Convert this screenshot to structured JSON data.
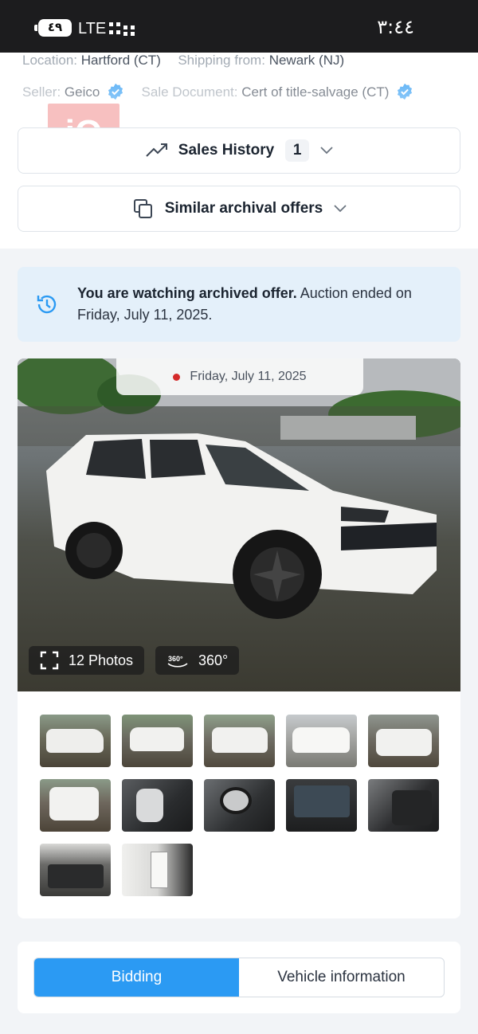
{
  "status_bar": {
    "battery": "٤٩",
    "network": "LTE",
    "time": "٣:٤٤"
  },
  "details": {
    "location_label": "Location:",
    "location_value": "Hartford (CT)",
    "shipping_label": "Shipping from:",
    "shipping_value": "Newark (NJ)",
    "seller_label": "Seller:",
    "seller_value": "Geico",
    "sale_doc_label": "Sale Document:",
    "sale_doc_value": "Cert of title-salvage (CT)"
  },
  "watermark": "iQ",
  "sales_history": {
    "label": "Sales History",
    "count": "1"
  },
  "similar_offers": {
    "label": "Similar archival offers"
  },
  "archive_banner": {
    "bold": "You are watching archived offer.",
    "rest": " Auction ended on Friday, July 11, 2025."
  },
  "gallery": {
    "date": "Friday, July 11, 2025",
    "photos_label": "12 Photos",
    "view360_badge": "360°",
    "view360_label": "360°",
    "thumbnails": [
      {
        "name": "front-left"
      },
      {
        "name": "rear-left"
      },
      {
        "name": "front-angle"
      },
      {
        "name": "front-right"
      },
      {
        "name": "front"
      },
      {
        "name": "rear"
      },
      {
        "name": "airbags"
      },
      {
        "name": "interior-wheel"
      },
      {
        "name": "dashboard"
      },
      {
        "name": "rear-seats"
      },
      {
        "name": "engine"
      },
      {
        "name": "door-sticker"
      }
    ]
  },
  "tabs": [
    {
      "label": "Bidding",
      "active": true
    },
    {
      "label": "Vehicle information",
      "active": false
    }
  ]
}
